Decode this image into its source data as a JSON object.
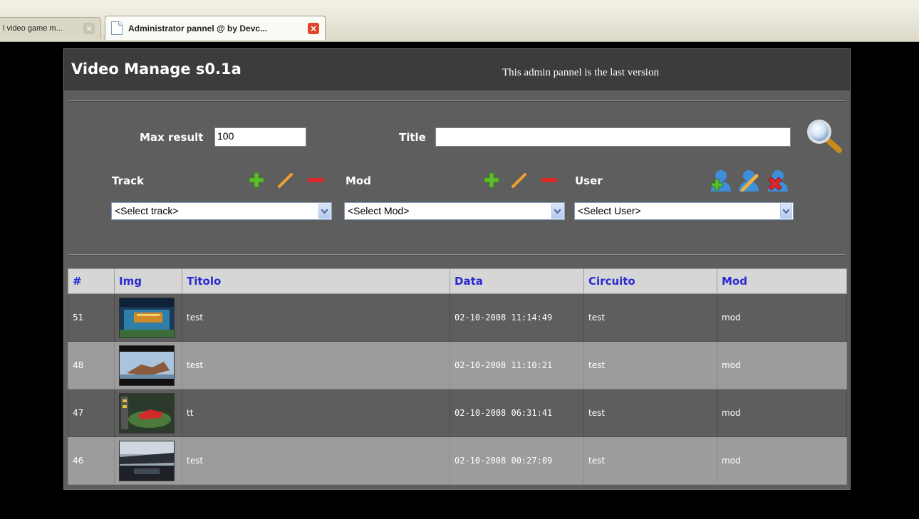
{
  "browser": {
    "tabs": [
      {
        "title": "l video game m...",
        "active": false
      },
      {
        "title": "Administrator pannel @ by Devc...",
        "active": true
      }
    ]
  },
  "header": {
    "title": "Video Manage s0.1a",
    "note": "This admin pannel is the last version"
  },
  "filters": {
    "max_result_label": "Max result",
    "max_result_value": "100",
    "title_label": "Title",
    "title_value": "",
    "track_label": "Track",
    "track_select": "<Select track>",
    "mod_label": "Mod",
    "mod_select": "<Select Mod>",
    "user_label": "User",
    "user_select": "<Select User>"
  },
  "icons": {
    "add": "plus-icon",
    "edit": "pencil-icon",
    "remove": "minus-icon",
    "user_add": "user-add-icon",
    "user_edit": "user-edit-icon",
    "user_remove": "user-remove-icon",
    "search": "magnifier-icon"
  },
  "colors": {
    "header_text": "#2a2ad0",
    "add_green": "#5cc02a",
    "edit_orange": "#f0a030",
    "remove_red": "#e02828"
  },
  "table": {
    "columns": [
      "#",
      "Img",
      "Titolo",
      "Data",
      "Circuito",
      "Mod"
    ],
    "rows": [
      {
        "id": "51",
        "title": "test",
        "date": "02-10-2008 11:14:49",
        "circuit": "test",
        "mod": "mod"
      },
      {
        "id": "48",
        "title": "test",
        "date": "02-10-2008 11:10:21",
        "circuit": "test",
        "mod": "mod"
      },
      {
        "id": "47",
        "title": "tt",
        "date": "02-10-2008 06:31:41",
        "circuit": "test",
        "mod": "mod"
      },
      {
        "id": "46",
        "title": "test",
        "date": "02-10-2008 00:27:09",
        "circuit": "test",
        "mod": "mod"
      }
    ]
  }
}
